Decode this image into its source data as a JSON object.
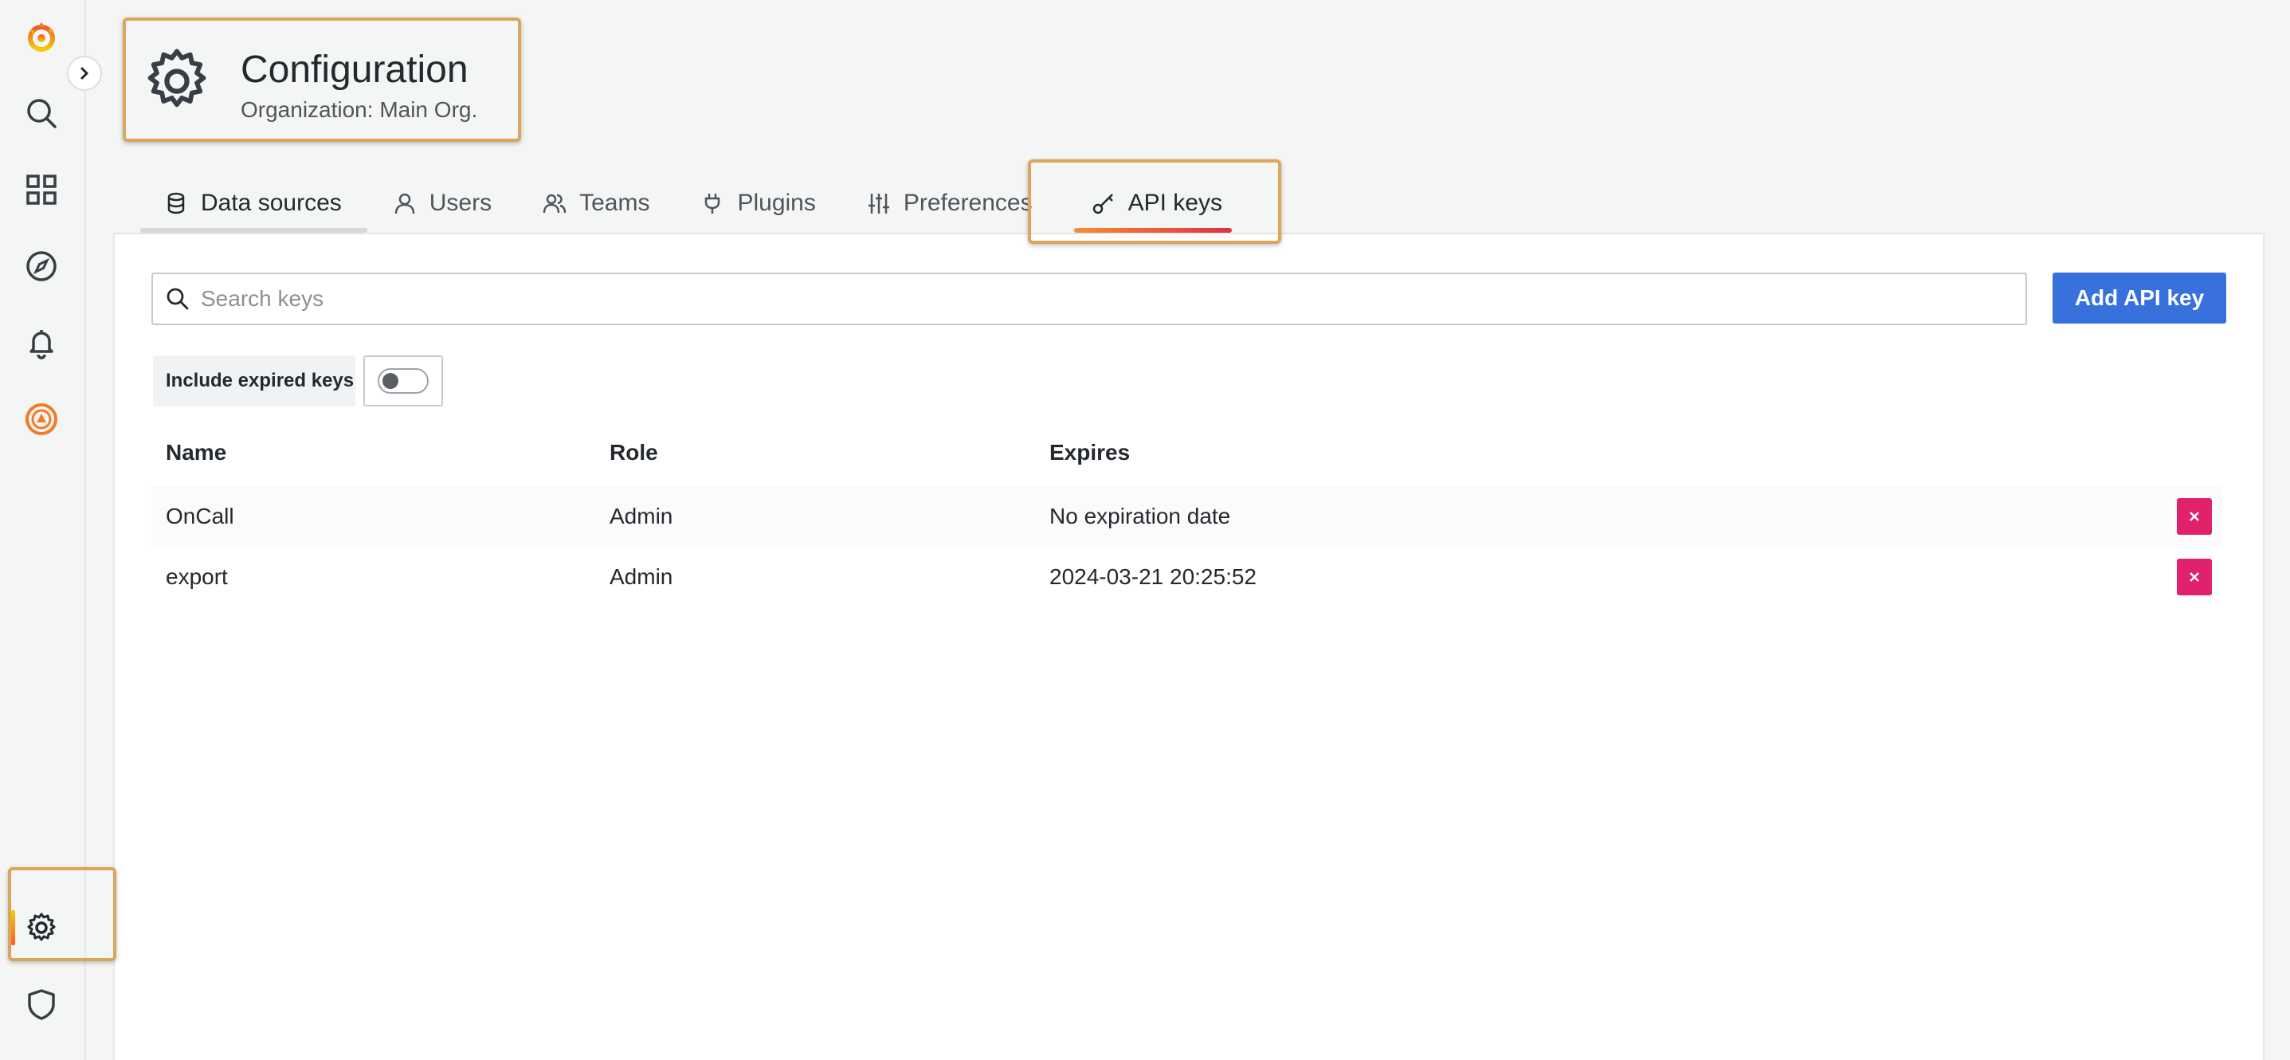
{
  "header": {
    "title": "Configuration",
    "subtitle": "Organization: Main Org."
  },
  "tabs": [
    {
      "label": "Data sources",
      "icon": "database-icon"
    },
    {
      "label": "Users",
      "icon": "user-icon"
    },
    {
      "label": "Teams",
      "icon": "users-icon"
    },
    {
      "label": "Plugins",
      "icon": "plug-icon"
    },
    {
      "label": "Preferences",
      "icon": "sliders-icon"
    },
    {
      "label": "API keys",
      "icon": "key-icon",
      "active": true
    }
  ],
  "search": {
    "placeholder": "Search keys",
    "value": ""
  },
  "actions": {
    "add_label": "Add API key"
  },
  "filter": {
    "include_expired_label": "Include expired keys",
    "include_expired": false
  },
  "table": {
    "columns": [
      "Name",
      "Role",
      "Expires"
    ],
    "rows": [
      {
        "name": "OnCall",
        "role": "Admin",
        "expires": "No expiration date"
      },
      {
        "name": "export",
        "role": "Admin",
        "expires": "2024-03-21 20:25:52"
      }
    ]
  },
  "sidebar": {
    "items": [
      "grafana-logo-icon",
      "search-icon",
      "dashboards-icon",
      "explore-icon",
      "alerting-icon",
      "oncall-icon",
      "configuration-icon",
      "shield-icon"
    ],
    "active": "configuration-icon"
  },
  "colors": {
    "primary_button": "#3871dc",
    "danger_button": "#e0226e",
    "highlight_box": "#d9a65a",
    "active_tab_underline": "#e02f44"
  }
}
